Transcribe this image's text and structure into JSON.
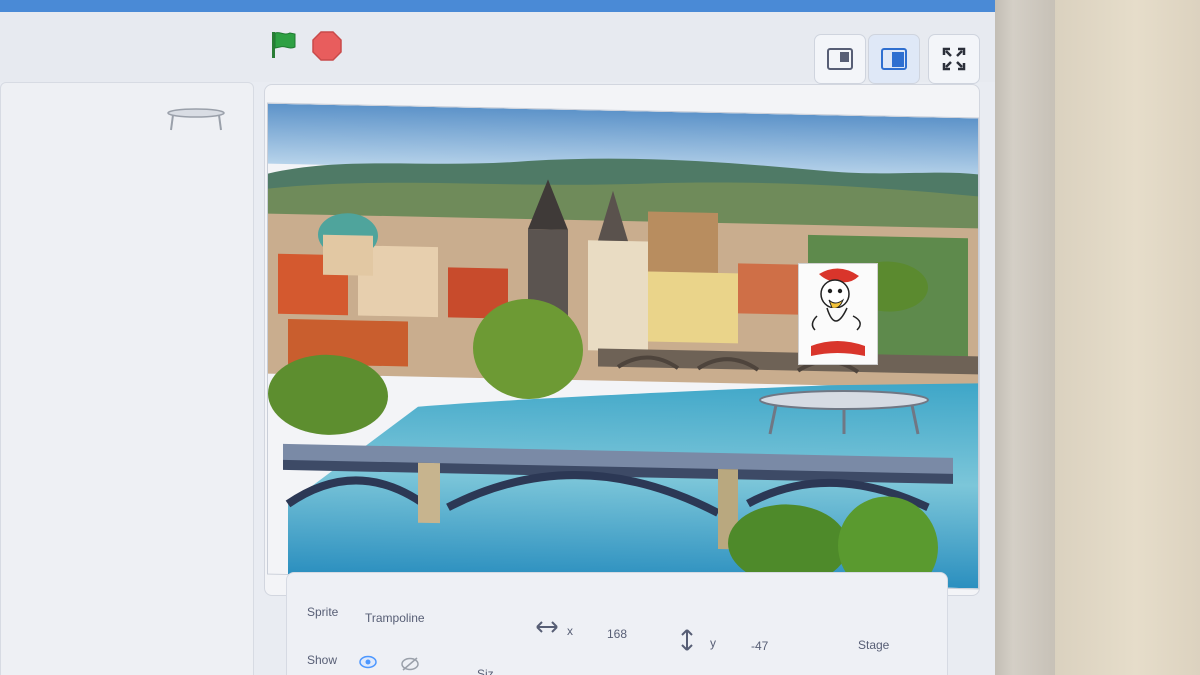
{
  "toolbar": {
    "green_flag_icon": "green-flag-icon",
    "stop_icon": "stop-sign-icon",
    "buttons": [
      "small-stage-icon",
      "normal-stage-icon",
      "fullscreen-icon"
    ],
    "colors": {
      "flag": "#2ea043",
      "stop": "#e85d5d",
      "accent": "#4a8ad6"
    }
  },
  "info": {
    "sprite_label": "Sprite",
    "sprite_name": "Trampoline",
    "x_label": "x",
    "x_value": "168",
    "y_label": "y",
    "y_value": "-47",
    "show_label": "Show",
    "size_label": "Siz",
    "stage_label": "Stage"
  }
}
